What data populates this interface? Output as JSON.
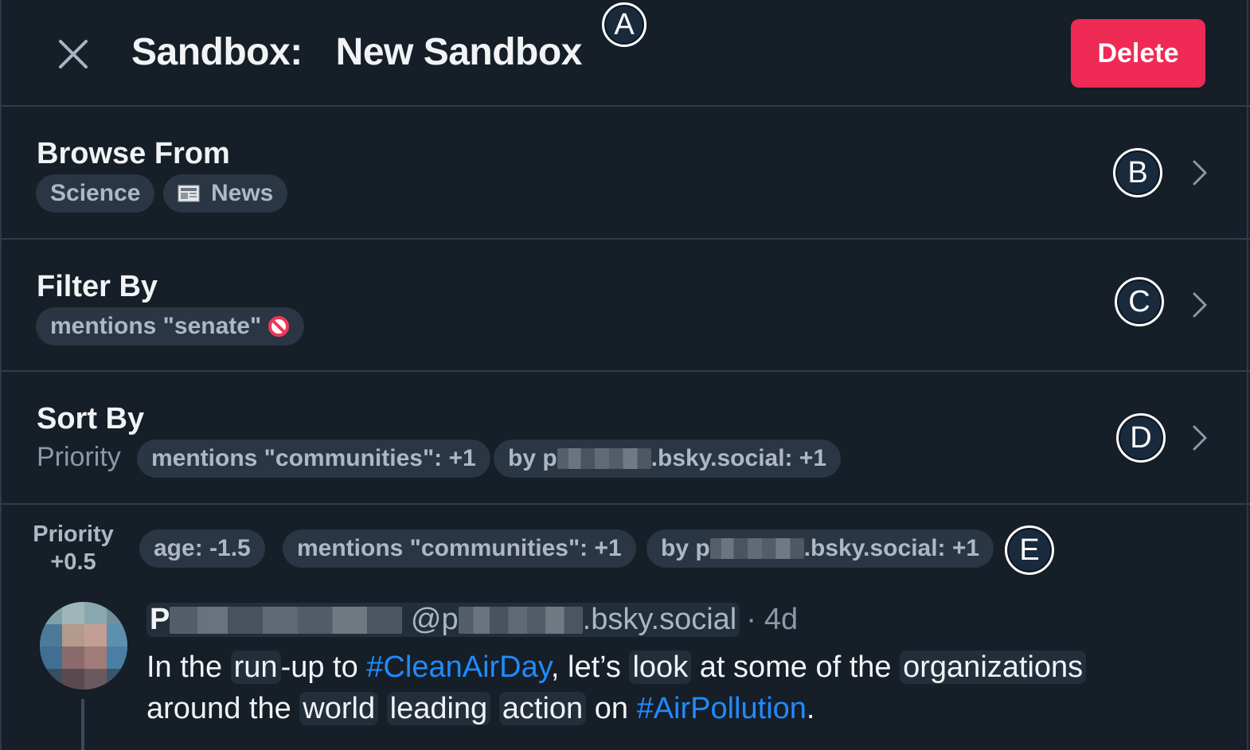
{
  "header": {
    "title_prefix": "Sandbox:",
    "title_name": "New Sandbox",
    "delete_label": "Delete",
    "marker": "A"
  },
  "browse": {
    "title": "Browse From",
    "chips": [
      "Science",
      "News"
    ],
    "marker": "B"
  },
  "filter": {
    "title": "Filter By",
    "chip": "mentions \"senate\"",
    "marker": "C"
  },
  "sort": {
    "title": "Sort By",
    "mode": "Priority",
    "chips": [
      "mentions \"communities\": +1",
      "by p",
      ".bsky.social: +1"
    ],
    "marker": "D"
  },
  "post": {
    "priority_label": "Priority",
    "priority_value": "+0.5",
    "chips": [
      "age: -1.5",
      "mentions \"communities\": +1",
      "by p",
      ".bsky.social: +1"
    ],
    "marker": "E",
    "author_initial": "P",
    "handle_prefix": "@p",
    "handle_suffix": ".bsky.social",
    "separator": "·",
    "time": "4d",
    "text_parts": [
      "In the ",
      "run",
      "-up to ",
      "#CleanAirDay",
      ", let’s ",
      "look",
      " at some of the ",
      "organizations",
      "around the ",
      "world",
      " ",
      "leading",
      " ",
      "action",
      " on ",
      "#AirPollution",
      "."
    ]
  },
  "colors": {
    "background": "#161e27",
    "accent_red": "#ef2a55",
    "link_blue": "#208bfe",
    "chip_bg": "#2a3644"
  },
  "icons": [
    "close-icon",
    "news-icon",
    "prohibited-icon",
    "chevron-right-icon"
  ]
}
